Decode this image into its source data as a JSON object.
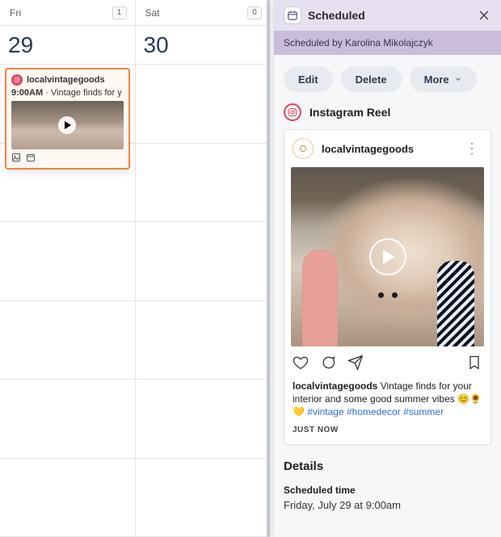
{
  "calendar": {
    "days": [
      {
        "weekday": "Fri",
        "date": "29",
        "count": "1"
      },
      {
        "weekday": "Sat",
        "date": "30",
        "count": "0"
      }
    ],
    "event": {
      "account": "localvintagegoods",
      "time": "9:00AM",
      "separator": " · ",
      "caption_preview": "Vintage finds for y"
    }
  },
  "panel": {
    "title": "Scheduled",
    "subtitle": "Scheduled by Karolina Mikolajczyk",
    "actions": {
      "edit": "Edit",
      "delete": "Delete",
      "more": "More"
    },
    "platform_label": "Instagram Reel",
    "preview": {
      "account": "localvintagegoods",
      "caption_account": "localvintagegoods",
      "caption_text": "Vintage finds for your interior and some good summer vibes ",
      "caption_emoji": "😊🌻💛 ",
      "caption_tags": "#vintage #homedecor #summer",
      "posted": "JUST NOW"
    },
    "details": {
      "heading": "Details",
      "scheduled_time_label": "Scheduled time",
      "scheduled_time_value": "Friday, July 29 at 9:00am"
    }
  }
}
